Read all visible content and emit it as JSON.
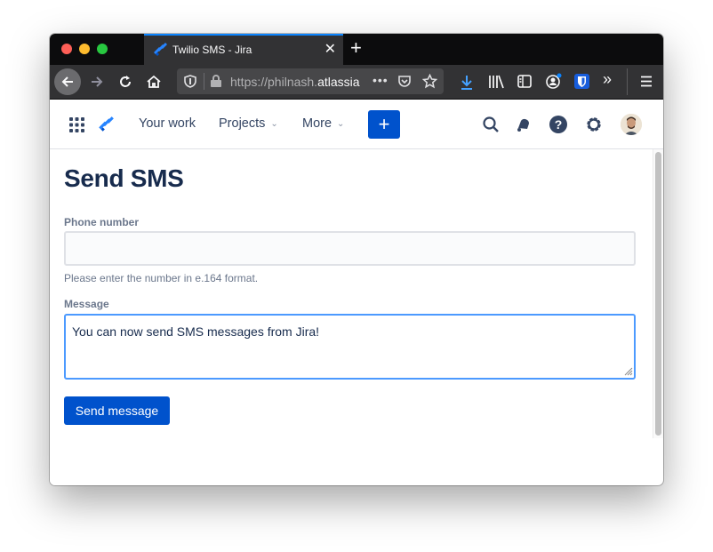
{
  "browser": {
    "tab": {
      "title": "Twilio SMS - Jira",
      "close_glyph": "✕"
    },
    "new_tab_glyph": "+",
    "url": {
      "prefix": "https://philnash.",
      "domain": "atlassia",
      "full_visible": "https://philnash.atlassia"
    },
    "toolbar_icons": [
      "back-icon",
      "forward-icon",
      "reload-icon",
      "home-icon",
      "tracking-shield-icon",
      "lock-icon",
      "page-actions-icon",
      "pocket-icon",
      "bookmark-star-icon",
      "download-icon",
      "library-icon",
      "sidebar-icon",
      "account-icon",
      "bitwarden-icon",
      "overflow-icon",
      "menu-icon"
    ]
  },
  "jira": {
    "nav": [
      {
        "label": "Your work",
        "dropdown": false
      },
      {
        "label": "Projects",
        "dropdown": true
      },
      {
        "label": "More",
        "dropdown": true
      }
    ],
    "create_label": "+",
    "brand_color": "#0052cc",
    "right_icons": [
      "search-icon",
      "notifications-icon",
      "help-icon",
      "settings-icon",
      "avatar"
    ]
  },
  "form": {
    "title": "Send SMS",
    "phone": {
      "label": "Phone number",
      "value": "",
      "help": "Please enter the number in e.164 format."
    },
    "message": {
      "label": "Message",
      "value": "You can now send SMS messages from Jira!"
    },
    "submit_label": "Send message"
  }
}
